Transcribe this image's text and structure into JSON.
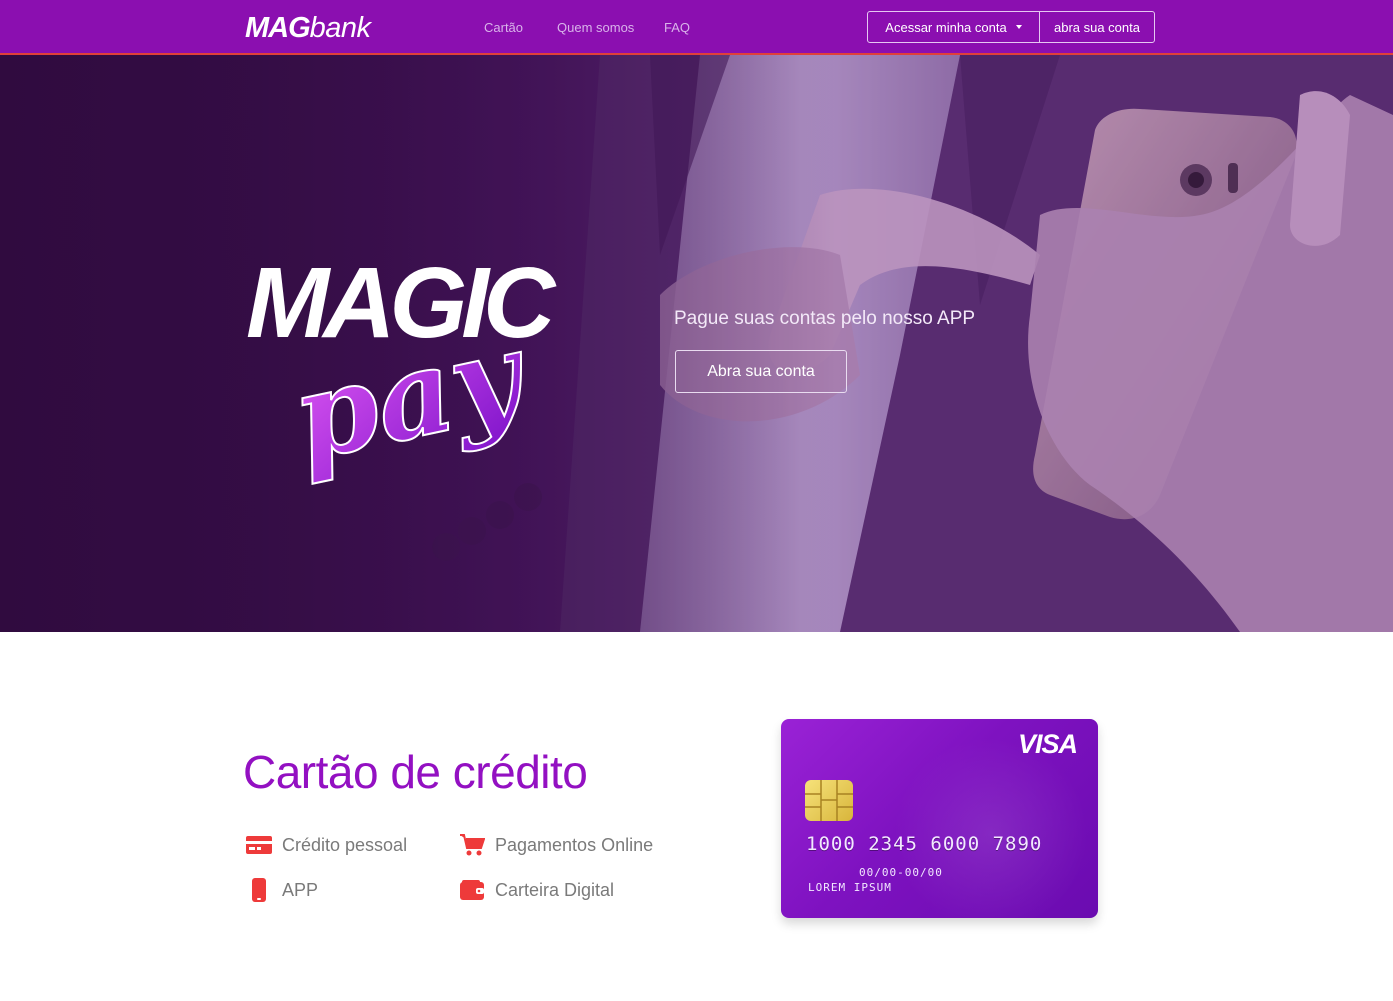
{
  "header": {
    "logo_bold": "MAG",
    "logo_light": "bank",
    "nav": [
      "Cartão",
      "Quem somos",
      "FAQ"
    ],
    "login_label": "Acessar minha conta",
    "open_account_label": "abra sua conta"
  },
  "hero": {
    "logo_word1": "MAGIC",
    "logo_word2": "pay",
    "tagline": "Pague suas contas pelo nosso APP",
    "cta_label": "Abra sua conta"
  },
  "credit": {
    "title": "Cartão de crédito",
    "features": [
      {
        "label": "Crédito pessoal",
        "icon": "credit-card-icon"
      },
      {
        "label": "Pagamentos Online",
        "icon": "shopping-cart-icon"
      },
      {
        "label": "APP",
        "icon": "mobile-phone-icon"
      },
      {
        "label": "Carteira Digital",
        "icon": "wallet-icon"
      }
    ],
    "card": {
      "brand": "VISA",
      "number": "1000 2345 6000 7890",
      "validity": "00/00-00/00",
      "holder": "LOREM IPSUM"
    }
  },
  "colors": {
    "brand_purple": "#8b0fb0",
    "accent_red": "#e0403a",
    "title_purple": "#9310c2"
  }
}
